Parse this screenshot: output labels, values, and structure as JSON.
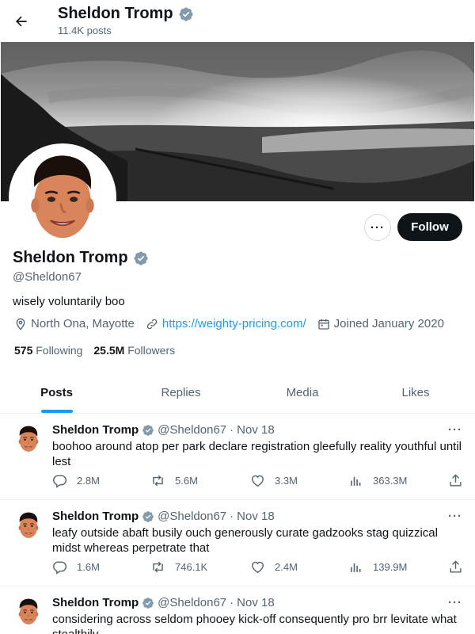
{
  "header": {
    "title": "Sheldon Tromp",
    "post_count": "11.4K posts"
  },
  "profile": {
    "name": "Sheldon Tromp",
    "handle": "@Sheldon67",
    "bio": "wisely voluntarily boo",
    "location": "North Ona, Mayotte",
    "website": "https://weighty-pricing.com/",
    "joined": "Joined January 2020",
    "following_count": "575",
    "following_label": "Following",
    "followers_count": "25.5M",
    "followers_label": "Followers",
    "more_label": "···",
    "follow_label": "Follow",
    "verified": true
  },
  "tabs": [
    {
      "label": "Posts",
      "active": true
    },
    {
      "label": "Replies",
      "active": false
    },
    {
      "label": "Media",
      "active": false
    },
    {
      "label": "Likes",
      "active": false
    }
  ],
  "posts": [
    {
      "name": "Sheldon Tromp",
      "handle": "@Sheldon67",
      "sep": "·",
      "date": "Nov 18",
      "text": "boohoo around atop per park declare registration gleefully reality youthful until lest",
      "replies": "2.8M",
      "reposts": "5.6M",
      "likes": "3.3M",
      "views": "363.3M",
      "menu": "···"
    },
    {
      "name": "Sheldon Tromp",
      "handle": "@Sheldon67",
      "sep": "·",
      "date": "Nov 18",
      "text": "leafy outside abaft busily ouch generously curate gadzooks stag quizzical midst whereas perpetrate that",
      "replies": "1.6M",
      "reposts": "746.1K",
      "likes": "2.4M",
      "views": "139.9M",
      "menu": "···"
    },
    {
      "name": "Sheldon Tromp",
      "handle": "@Sheldon67",
      "sep": "·",
      "date": "Nov 18",
      "text": "considering across seldom phooey kick-off consequently pro brr levitate what stealthily",
      "replies": "",
      "reposts": "",
      "likes": "",
      "views": "",
      "menu": "···"
    }
  ],
  "colors": {
    "accent": "#1d9bf0",
    "text": "#0f1419",
    "muted": "#536471",
    "verified": "#829aab"
  }
}
